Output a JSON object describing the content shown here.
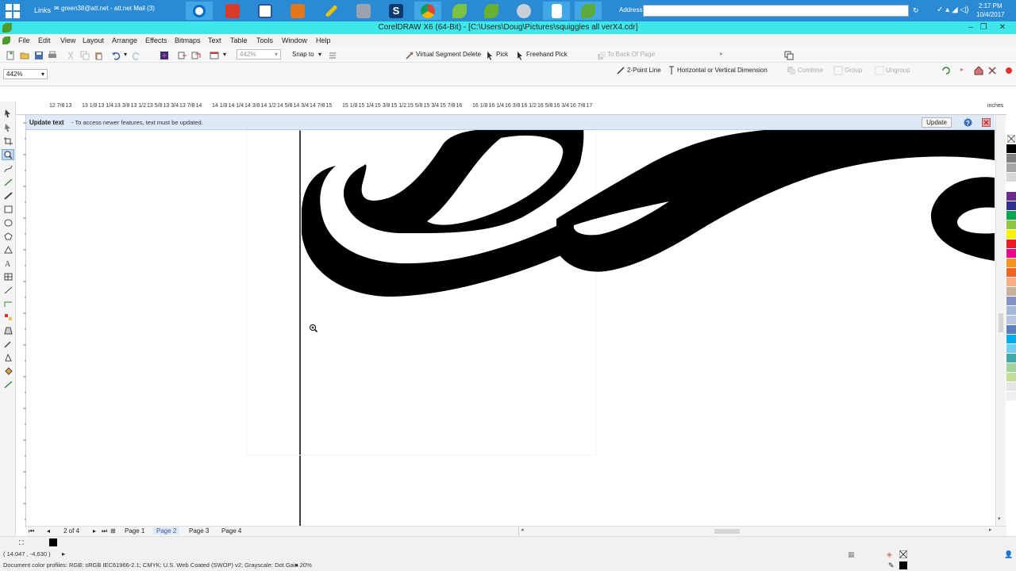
{
  "taskbar": {
    "links_label": "Links",
    "mail_tab_label": "green38@att.net - att.net Mail (3)",
    "address_label": "Address",
    "clock_time": "2:17 PM",
    "clock_date": "10/4/2017",
    "pinned_icons": [
      "ie-icon",
      "grid-app-icon",
      "word-icon",
      "fox-app-icon",
      "pen-app-icon",
      "settings-app-icon",
      "s-app-icon",
      "chrome-icon",
      "leaf-app-icon",
      "leaf-app-icon-2",
      "globe-app-icon",
      "blank-app-icon",
      "coreldraw-icon"
    ]
  },
  "window": {
    "title": "CorelDRAW X6 (64-Bit) - [C:\\Users\\Doug\\Pictures\\squiggles all verX4.cdr]"
  },
  "menu": [
    "File",
    "Edit",
    "View",
    "Layout",
    "Arrange",
    "Effects",
    "Bitmaps",
    "Text",
    "Table",
    "Tools",
    "Window",
    "Help"
  ],
  "toolbar1": {
    "zoom_value": "442%",
    "snap_to": "Snap to",
    "virtual_segment_delete": "Virtual Segment Delete",
    "pick": "Pick",
    "freehand_pick": "Freehand Pick",
    "to_back_of_page": "To Back Of Page"
  },
  "toolbar2": {
    "zoom_value": "442%",
    "two_point_line": "2-Point Line",
    "dimension": "Horizontal or Vertical Dimension",
    "combine": "Combine",
    "group": "Group",
    "ungroup": "Ungroup"
  },
  "ruler": {
    "top_labels": [
      "12 7/8",
      "13",
      "13 1/8",
      "13 1/4",
      "13 3/8",
      "13 1/2",
      "13 5/8",
      "13 3/4",
      "13 7/8",
      "14",
      "14 1/8",
      "14 1/4",
      "14 3/8",
      "14 1/2",
      "14 5/8",
      "14 3/4",
      "14 7/8",
      "15",
      "15 1/8",
      "15 1/4",
      "15 3/8",
      "15 1/2",
      "15 5/8",
      "15 3/4",
      "15 7/8",
      "16",
      "16 1/8",
      "16 1/4",
      "16 3/8",
      "16 1/2",
      "16 5/8",
      "16 3/4",
      "16 7/8",
      "17"
    ],
    "unit": "inches"
  },
  "notification": {
    "title": "Update text",
    "message": "- To access newer features, text must be updated.",
    "button": "Update"
  },
  "pages": {
    "counter": "2 of 4",
    "tabs": [
      "Page 1",
      "Page 2",
      "Page 3",
      "Page 4"
    ],
    "active_index": 1
  },
  "status": {
    "coordinates": "( 14.047 , -4.630 )",
    "color_profiles": "Document color profiles: RGB: sRGB IEC61966-2.1; CMYK: U.S. Web Coated (SWOP) v2; Grayscale: Dot Gain 20%"
  },
  "palette_colors": [
    "#ffffff",
    "#000000",
    "#7f7f7f",
    "#a5a5a5",
    "#d8d8d8",
    "#ffffff",
    "#6a2d8f",
    "#2e3192",
    "#00a651",
    "#8dc63f",
    "#fff200",
    "#ed1c24",
    "#ec008c",
    "#f7941d",
    "#f26522",
    "#f9ad81",
    "#c7b299",
    "#8393ca",
    "#a4b8d6",
    "#b7c5e0",
    "#5a7fbf",
    "#00aeef",
    "#6dcff6",
    "#3fa9a5",
    "#a3d39c",
    "#c4df9b",
    "#e6e6e6",
    "#f0f0f0"
  ]
}
